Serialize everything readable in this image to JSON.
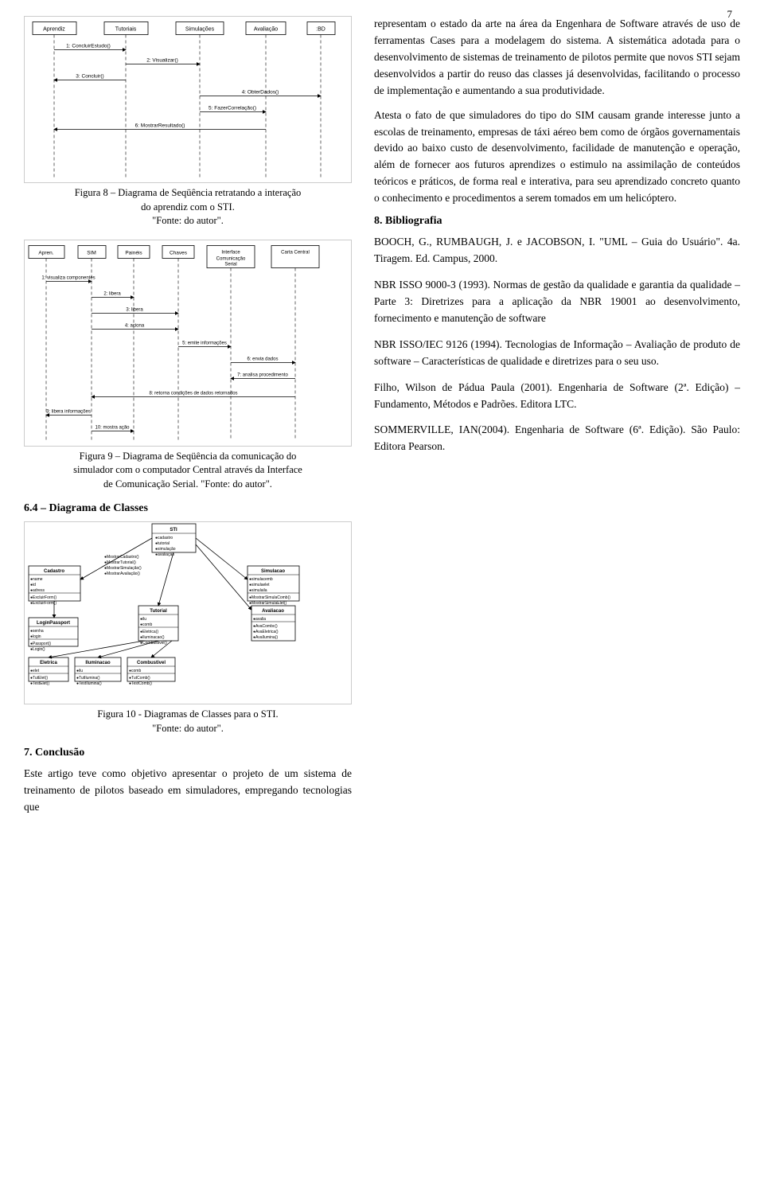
{
  "page": {
    "number": "7"
  },
  "left": {
    "fig8": {
      "caption_line1": "Figura 8 – Diagrama de Seqüência retratando a interação",
      "caption_line2": "do aprendiz com o STI.",
      "caption_line3": "\"Fonte: do autor\"."
    },
    "fig9": {
      "caption_line1": "Figura 9 – Diagrama de Seqüência da comunicação do",
      "caption_line2": "simulador com o computador Central através da Interface",
      "caption_line3": "de Comunicação Serial. \"Fonte: do autor\"."
    },
    "section64": {
      "title": "6.4 – Diagrama de Classes"
    },
    "fig10": {
      "caption_line1": "Figura 10 - Diagramas de Classes para o STI.",
      "caption_line2": "\"Fonte: do autor\"."
    },
    "section7": {
      "title": "7. Conclusão"
    },
    "conclusao": {
      "text": "Este artigo teve como objetivo apresentar o projeto de um sistema de treinamento de pilotos baseado em simuladores, empregando tecnologias que"
    }
  },
  "right": {
    "paragraph1": "representam o estado da arte na área da Engenhara de Software através de uso de ferramentas Cases para a modelagem do sistema. A sistemática adotada para o desenvolvimento de sistemas de treinamento de pilotos permite que novos STI sejam desenvolvidos a partir do reuso das classes já desenvolvidas, facilitando o processo de implementação e aumentando a sua produtividade.",
    "paragraph2": "Atesta o fato de que simuladores do tipo do SIM causam grande interesse junto a escolas de treinamento, empresas de táxi aéreo bem como de órgãos governamentais devido ao baixo custo de desenvolvimento, facilidade de manutenção e operação, além de fornecer aos futuros aprendizes o estimulo na assimilação de conteúdos teóricos e práticos, de forma real e interativa, para seu aprendizado concreto quanto o conhecimento e procedimentos a serem tomados em um helicóptero.",
    "section8": {
      "title": "8. Bibliografia"
    },
    "ref1": "BOOCH, G., RUMBAUGH, J. e JACOBSON, I. \"UML – Guia do Usuário\". 4a. Tiragem. Ed. Campus, 2000.",
    "ref2": "NBR ISSO 9000-3 (1993). Normas de gestão da qualidade e garantia da qualidade – Parte 3: Diretrizes para a aplicação da NBR 19001 ao desenvolvimento, fornecimento e manutenção de software",
    "ref3": "NBR ISSO/IEC 9126 (1994). Tecnologias de Informação – Avaliação de produto de software – Características de qualidade e diretrizes para o seu uso.",
    "ref4": "Filho, Wilson de Pádua Paula (2001). Engenharia de Software (2ª. Edição) – Fundamento, Métodos e Padrões. Editora LTC.",
    "ref5": "SOMMERVILLE, IAN(2004). Engenharia de Software (6ª. Edição). São Paulo: Editora Pearson."
  }
}
